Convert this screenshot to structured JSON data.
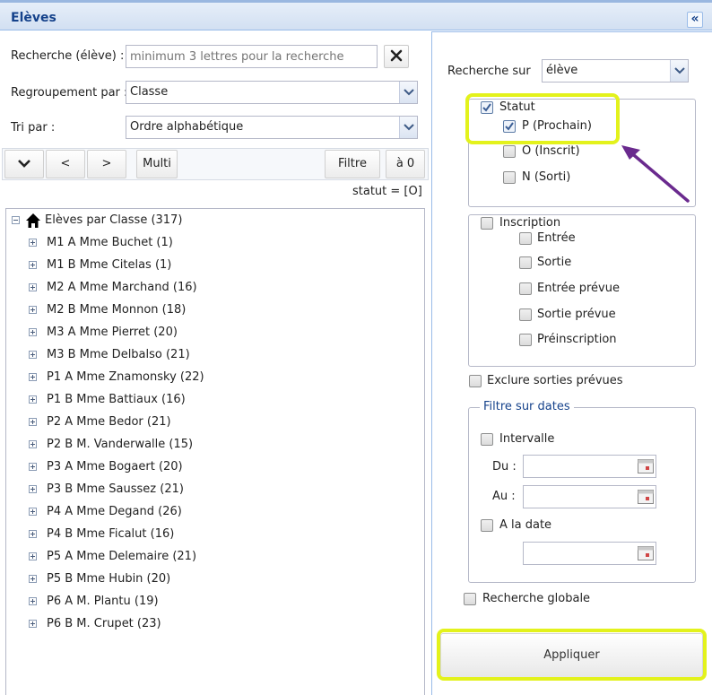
{
  "header": {
    "title": "Elèves",
    "collapse_icon": "double-chevron-left-icon"
  },
  "search": {
    "label": "Recherche (élève) :",
    "placeholder": "minimum 3 lettres pour la recherche",
    "value": ""
  },
  "grouping": {
    "label": "Regroupement par :",
    "value": "Classe"
  },
  "sort": {
    "label": "Tri par :",
    "value": "Ordre alphabétique"
  },
  "toolbar": {
    "prev": "<",
    "next": ">",
    "multi": "Multi",
    "filter": "Filtre",
    "reset": "à 0"
  },
  "status_text": "statut = [O]",
  "tree": {
    "root": "Elèves par Classe (317)",
    "items": [
      "M1 A Mme Buchet (1)",
      "M1 B Mme Citelas (1)",
      "M2 A Mme Marchand (16)",
      "M2 B Mme Monnon (18)",
      "M3 A Mme Pierret (20)",
      "M3 B Mme Delbalso (21)",
      "P1 A Mme Znamonsky (22)",
      "P1 B Mme Battiaux (16)",
      "P2 A Mme Bedor (21)",
      "P2 B M. Vanderwalle (15)",
      "P3 A Mme Bogaert (20)",
      "P3 B Mme Saussez (21)",
      "P4 A Mme Degand (26)",
      "P4 B Mme Ficalut (16)",
      "P5 A Mme Delemaire (21)",
      "P5 B Mme Hubin (20)",
      "P6 A M. Plantu (19)",
      "P6 B M. Crupet (23)"
    ]
  },
  "right": {
    "search_on_label": "Recherche sur",
    "search_on_value": "élève",
    "statut": {
      "label": "Statut",
      "checked": true,
      "options": [
        {
          "label": "P (Prochain)",
          "checked": true
        },
        {
          "label": "O (Inscrit)",
          "checked": false
        },
        {
          "label": "N (Sorti)",
          "checked": false
        }
      ]
    },
    "inscription": {
      "label": "Inscription",
      "checked": false,
      "options": [
        "Entrée",
        "Sortie",
        "Entrée prévue",
        "Sortie prévue",
        "Préinscription"
      ]
    },
    "exclude_label": "Exclure sorties prévues",
    "dates": {
      "legend": "Filtre sur dates",
      "interval_label": "Intervalle",
      "from_label": "Du :",
      "to_label": "Au :",
      "at_date_label": "A la date",
      "from_value": "",
      "to_value": "",
      "at_value": ""
    },
    "global_label": "Recherche globale",
    "apply_label": "Appliquer"
  },
  "colors": {
    "highlight": "#e3f21c",
    "arrow": "#6a2a8e",
    "header_text": "#15428b"
  }
}
